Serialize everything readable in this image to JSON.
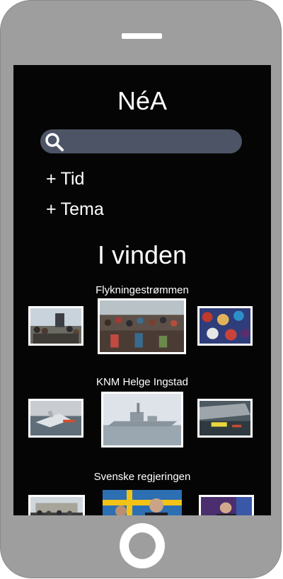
{
  "app": {
    "title": "NéA",
    "search": {
      "value": "",
      "placeholder": ""
    }
  },
  "filters": [
    {
      "plus": "+",
      "label": "Tid"
    },
    {
      "plus": "+",
      "label": "Tema"
    }
  ],
  "trending": {
    "heading": "I vinden",
    "topics": [
      {
        "label": "Flykningestrømmen"
      },
      {
        "label": "KNM Helge Ingstad"
      },
      {
        "label": "Svenske regjeringen"
      }
    ]
  },
  "icons": {
    "search": "search-icon"
  },
  "colors": {
    "screen_bg": "#050505",
    "phone_body": "#9e9e9e",
    "search_bg": "#4d5466",
    "text": "#ffffff"
  }
}
